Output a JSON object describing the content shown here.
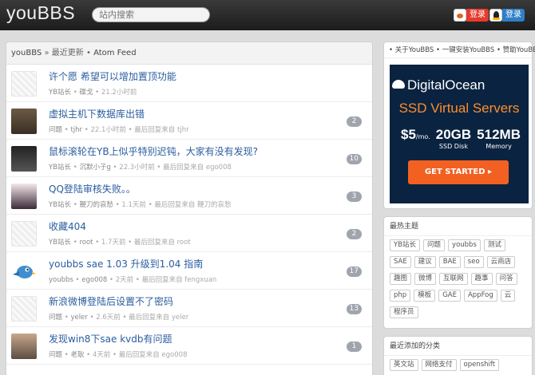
{
  "header": {
    "logo": "youBBS",
    "search_placeholder": "站内搜索",
    "weibo_login": "登录",
    "qq_login": "登录"
  },
  "breadcrumb": {
    "home": "youBBS",
    "sep": "»",
    "current": "最近更新",
    "dot": "•",
    "feed": "Atom Feed"
  },
  "topics": [
    {
      "title": "许个愿 希望可以增加置顶功能",
      "node": "YB站长",
      "author": "碟戈",
      "time": "21.2小时前",
      "last_reply": "",
      "replies": ""
    },
    {
      "title": "虚拟主机下数据库出错",
      "node": "问题",
      "author": "tjhr",
      "time": "22.1小时前",
      "last_reply": "最后回复来自 tjhr",
      "replies": "2"
    },
    {
      "title": "鼠标滚轮在YB上似乎特别迟钝，大家有没有发现?",
      "node": "YB站长",
      "author": "沉默小子g",
      "time": "22.3小时前",
      "last_reply": "最后回复来自 ego008",
      "replies": "10"
    },
    {
      "title": "QQ登陆审核失败。。",
      "node": "YB站长",
      "author": "鞭刀的哀愁",
      "time": "1.1天前",
      "last_reply": "最后回复来自 鞭刀的哀愁",
      "replies": "3"
    },
    {
      "title": "收藏404",
      "node": "YB站长",
      "author": "root",
      "time": "1.7天前",
      "last_reply": "最后回复来自 root",
      "replies": "2"
    },
    {
      "title": "youbbs sae 1.03 升级到1.04 指南",
      "node": "youbbs",
      "author": "ego008",
      "time": "2天前",
      "last_reply": "最后回复来自 fengxuan",
      "replies": "17"
    },
    {
      "title": "新浪微博登陆后设置不了密码",
      "node": "问题",
      "author": "yeler",
      "time": "2.6天前",
      "last_reply": "最后回复来自 yeler",
      "replies": "13"
    },
    {
      "title": "发现win8下sae kvdb有问题",
      "node": "问题",
      "author": "老耿",
      "time": "4天前",
      "last_reply": "最后回复来自 ego008",
      "replies": "1"
    }
  ],
  "sidebar": {
    "links": "• 关于YouBBS • 一键安装YouBBS • 赞助YouBBS",
    "ad": {
      "brand": "DigitalOcean",
      "headline": "SSD Virtual Servers",
      "price": "$5",
      "price_unit": "/mo.",
      "disk": "20GB",
      "disk_label": "SSD Disk",
      "memory": "512MB",
      "memory_label": "Memory",
      "cta": "GET STARTED ▸"
    },
    "hot_title": "最热主题",
    "hot_tags": [
      "YB站长",
      "问题",
      "youbbs",
      "测试",
      "SAE",
      "建议",
      "BAE",
      "seo",
      "云商店",
      "趣图",
      "微博",
      "互联网",
      "趣事",
      "问答",
      "php",
      "模板",
      "GAE",
      "AppFog",
      "云",
      "程序员"
    ],
    "nodes_title": "最近添加的分类",
    "node_tags": [
      "英文站",
      "网络支付",
      "openshift"
    ]
  }
}
